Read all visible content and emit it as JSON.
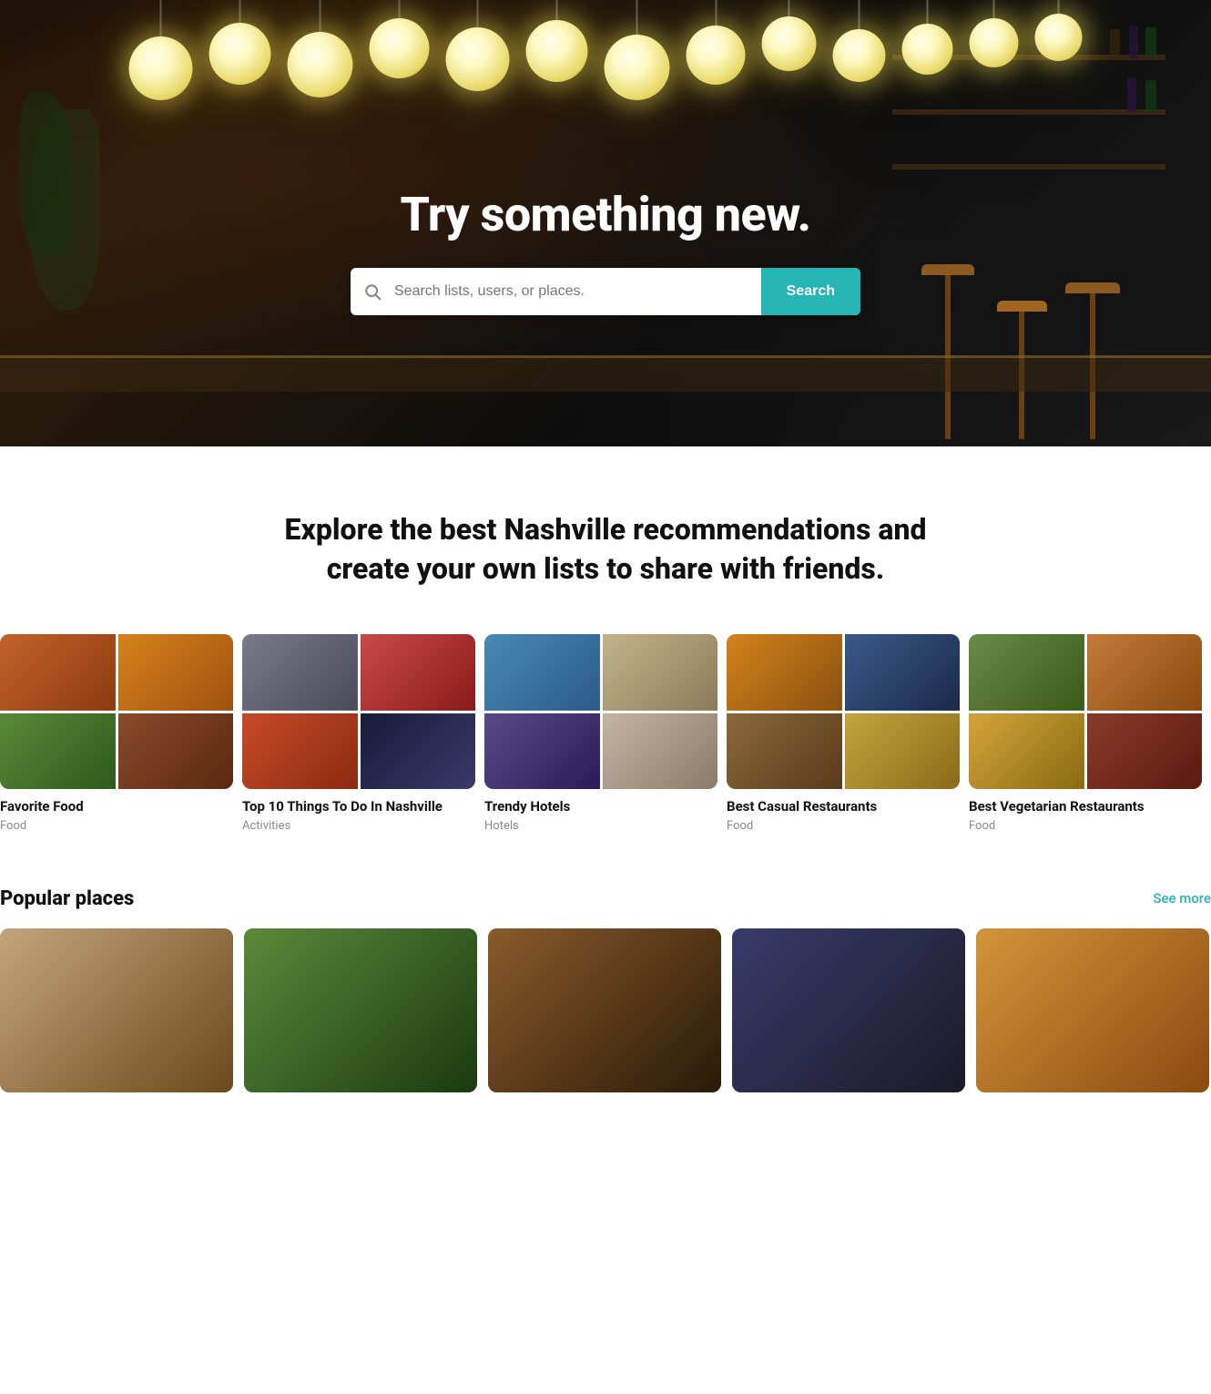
{
  "hero": {
    "title": "Try something new.",
    "search": {
      "placeholder": "Search lists, users, or places.",
      "button_label": "Search"
    },
    "lights_count": 13
  },
  "tagline": {
    "text": "Explore the best Nashville recommendations and create your own lists to share with friends."
  },
  "lists": {
    "items": [
      {
        "title": "Favorite Food",
        "category": "Food",
        "images": [
          "img-food-1",
          "img-food-2",
          "img-food-3",
          "img-food-4"
        ]
      },
      {
        "title": "Top 10 Things To Do In Nashville",
        "category": "Activities",
        "images": [
          "img-nashville-1",
          "img-nashville-2",
          "img-nashville-3",
          "img-nashville-4"
        ]
      },
      {
        "title": "Trendy Hotels",
        "category": "Hotels",
        "images": [
          "img-hotel-1",
          "img-hotel-2",
          "img-hotel-3",
          "img-hotel-4"
        ]
      },
      {
        "title": "Best Casual Restaurants",
        "category": "Food",
        "images": [
          "img-casual-1",
          "img-casual-2",
          "img-casual-3",
          "img-casual-4"
        ]
      },
      {
        "title": "Best Vegetarian Restaurants",
        "category": "Food",
        "images": [
          "img-veg-1",
          "img-veg-2",
          "img-veg-3",
          "img-veg-4"
        ]
      }
    ]
  },
  "popular_places": {
    "section_title": "Popular places",
    "see_more_label": "See more",
    "images": [
      "place-img-1",
      "place-img-2",
      "place-img-3",
      "place-img-4",
      "place-img-5"
    ]
  },
  "colors": {
    "accent": "#26b5b5",
    "accent_hover": "#1fa0a0",
    "text_primary": "#111111",
    "text_secondary": "#888888"
  }
}
